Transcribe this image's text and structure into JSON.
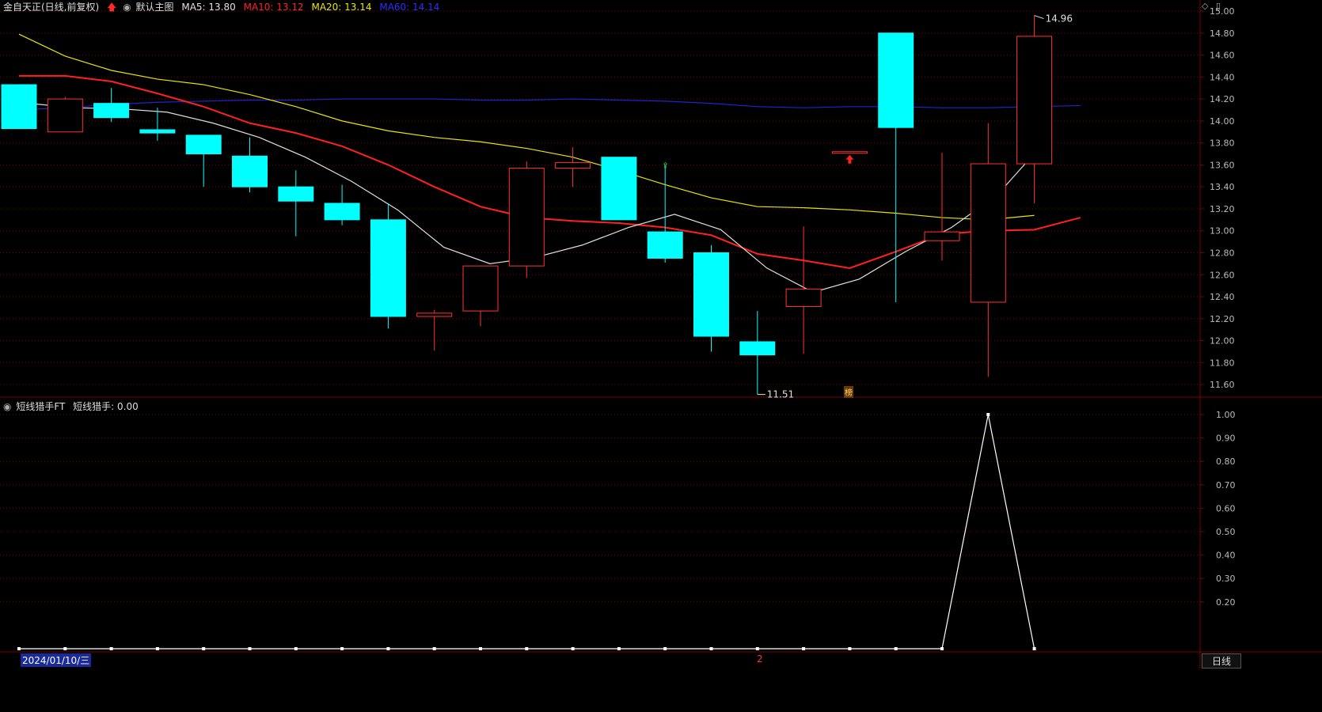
{
  "header": {
    "stock_title": "金自天正(日线,前复权)",
    "main_chart_label": "默认主图",
    "ma5_label": "MA5: 13.80",
    "ma10_label": "MA10: 13.12",
    "ma20_label": "MA20: 13.14",
    "ma60_label": "MA60: 14.14"
  },
  "colors": {
    "background": "#000000",
    "grid": "#7a0000",
    "up": "#ff3333",
    "down": "#00ffff",
    "ma5": "#e0e0e0",
    "ma10": "#ff2020",
    "ma20": "#e6e600",
    "ma60": "#2222cc",
    "axis_text": "#bbbbbb"
  },
  "indicator": {
    "label": "短线猎手FT",
    "value_label": "短线猎手: 0.00"
  },
  "price_axis": {
    "labels": [
      "15.00",
      "14.80",
      "14.60",
      "14.40",
      "14.20",
      "14.00",
      "13.80",
      "13.60",
      "13.40",
      "13.20",
      "13.00",
      "12.80",
      "12.60",
      "12.40",
      "12.20",
      "12.00",
      "11.80",
      "11.60"
    ]
  },
  "indicator_axis": {
    "labels": [
      "1.00",
      "0.90",
      "0.80",
      "0.70",
      "0.60",
      "0.50",
      "0.40",
      "0.30",
      "0.20"
    ]
  },
  "annotations": {
    "high_label": "14.96",
    "low_label": "11.51",
    "badge": "榜"
  },
  "footer": {
    "date_label": "2024/01/10/三",
    "period_button": "日线",
    "marker": "2"
  },
  "chart_data": {
    "type": "candlestick",
    "candles": [
      {
        "o": 14.33,
        "h": 14.33,
        "l": 13.93,
        "c": 13.93
      },
      {
        "o": 13.9,
        "h": 14.22,
        "l": 13.9,
        "c": 14.2
      },
      {
        "o": 14.16,
        "h": 14.3,
        "l": 13.99,
        "c": 14.03
      },
      {
        "o": 13.92,
        "h": 14.12,
        "l": 13.82,
        "c": 13.89
      },
      {
        "o": 13.87,
        "h": 13.87,
        "l": 13.4,
        "c": 13.7
      },
      {
        "o": 13.68,
        "h": 13.85,
        "l": 13.35,
        "c": 13.4
      },
      {
        "o": 13.4,
        "h": 13.55,
        "l": 12.95,
        "c": 13.27
      },
      {
        "o": 13.25,
        "h": 13.42,
        "l": 13.05,
        "c": 13.1
      },
      {
        "o": 13.1,
        "h": 13.25,
        "l": 12.11,
        "c": 12.22
      },
      {
        "o": 12.22,
        "h": 12.28,
        "l": 11.91,
        "c": 12.25
      },
      {
        "o": 12.27,
        "h": 12.68,
        "l": 12.13,
        "c": 12.68
      },
      {
        "o": 12.68,
        "h": 13.63,
        "l": 12.57,
        "c": 13.57
      },
      {
        "o": 13.57,
        "h": 13.76,
        "l": 13.4,
        "c": 13.62
      },
      {
        "o": 13.67,
        "h": 13.67,
        "l": 13.1,
        "c": 13.1
      },
      {
        "o": 12.99,
        "h": 13.6,
        "l": 12.71,
        "c": 12.75
      },
      {
        "o": 12.8,
        "h": 12.87,
        "l": 11.9,
        "c": 12.04
      },
      {
        "o": 11.99,
        "h": 12.27,
        "l": 11.51,
        "c": 11.87
      },
      {
        "o": 12.31,
        "h": 13.04,
        "l": 11.88,
        "c": 12.47
      },
      {
        "o": 13.72,
        "h": 13.72,
        "l": 13.72,
        "c": 13.72
      },
      {
        "o": 14.8,
        "h": 14.8,
        "l": 12.35,
        "c": 13.94
      },
      {
        "o": 12.91,
        "h": 13.71,
        "l": 12.73,
        "c": 12.99
      },
      {
        "o": 12.35,
        "h": 13.98,
        "l": 11.67,
        "c": 13.61
      },
      {
        "o": 13.61,
        "h": 14.96,
        "l": 13.25,
        "c": 14.77
      }
    ],
    "ma5": [
      14.16,
      14.12,
      14.11,
      14.08,
      13.98,
      13.85,
      13.67,
      13.45,
      13.19,
      12.85,
      12.7,
      12.76,
      12.87,
      13.03,
      13.15,
      13.01,
      12.66,
      12.44,
      12.56,
      12.81,
      13.03,
      13.33,
      13.8
    ],
    "ma10": [
      14.41,
      14.41,
      14.36,
      14.25,
      14.13,
      13.98,
      13.89,
      13.77,
      13.6,
      13.4,
      13.22,
      13.12,
      13.09,
      13.07,
      13.03,
      12.96,
      12.79,
      12.73,
      12.66,
      12.81,
      12.97,
      13.0,
      13.01,
      13.12
    ],
    "ma20": [
      14.79,
      14.59,
      14.46,
      14.38,
      14.33,
      14.24,
      14.13,
      14.0,
      13.91,
      13.85,
      13.81,
      13.75,
      13.67,
      13.55,
      13.42,
      13.3,
      13.22,
      13.21,
      13.19,
      13.16,
      13.12,
      13.1,
      13.14
    ],
    "ma60": [
      14.1,
      14.12,
      14.15,
      14.17,
      14.18,
      14.19,
      14.19,
      14.2,
      14.2,
      14.2,
      14.19,
      14.19,
      14.2,
      14.19,
      14.18,
      14.16,
      14.13,
      14.12,
      14.13,
      14.13,
      14.12,
      14.12,
      14.13,
      14.14
    ],
    "indicator_values": [
      0,
      0,
      0,
      0,
      0,
      0,
      0,
      0,
      0,
      0,
      0,
      0,
      0,
      0,
      0,
      0,
      0,
      0,
      0,
      0,
      0,
      1,
      0
    ],
    "price_ylim": [
      11.5,
      15.0
    ],
    "indicator_ylim": [
      0,
      1.0
    ]
  }
}
